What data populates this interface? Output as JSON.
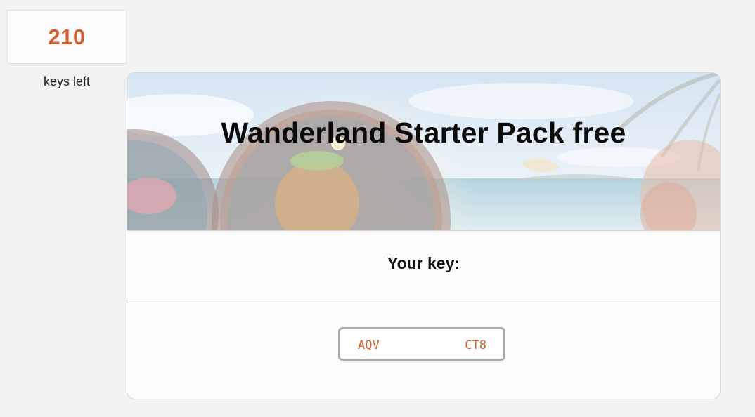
{
  "counter": {
    "value": "210",
    "label": "keys left"
  },
  "card": {
    "title": "Wanderland Starter Pack free",
    "key_heading": "Your key:",
    "key": {
      "start": "AQV",
      "end": "CT8"
    }
  },
  "colors": {
    "accent": "#d35f30",
    "page_background": "#f2f2f2",
    "card_background": "#fbfbfb"
  }
}
